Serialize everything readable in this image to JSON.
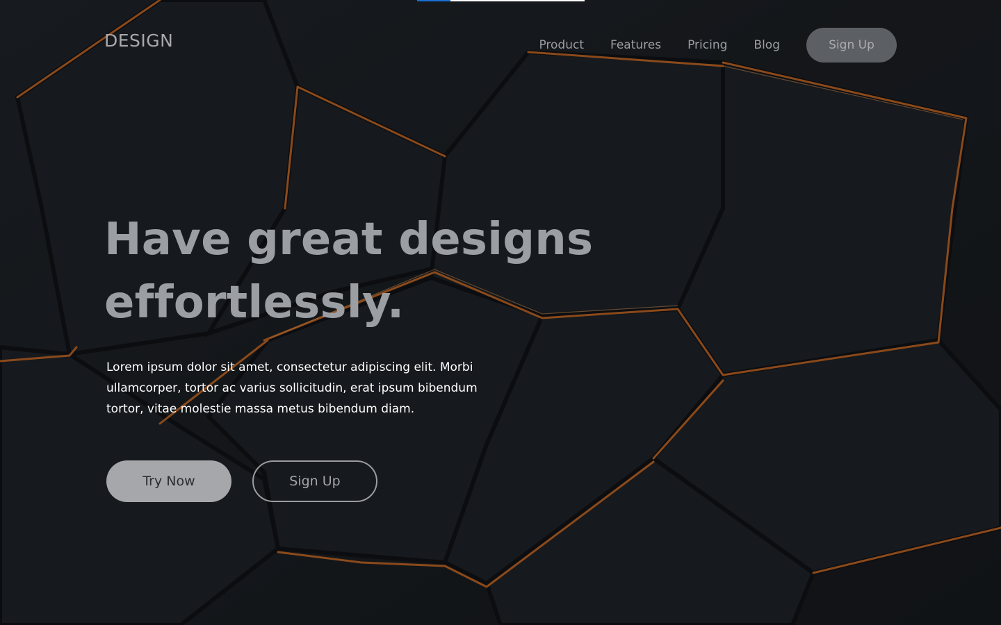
{
  "progress": {
    "value": 0.2,
    "fill_color": "#1a6fd6",
    "track_color": "#ffffff"
  },
  "brand": {
    "logo_text": "DESIGN"
  },
  "nav": {
    "links": [
      "Product",
      "Features",
      "Pricing",
      "Blog"
    ],
    "signup_label": "Sign Up"
  },
  "hero": {
    "title": "Have great designs effortlessly.",
    "body": "Lorem ipsum dolor sit amet, consectetur adipiscing elit. Morbi ullamcorper, tortor ac varius sollicitudin, erat ipsum bibendum tortor, vitae molestie massa metus bibendum diam.",
    "primary_button": "Try Now",
    "secondary_button": "Sign Up"
  },
  "colors": {
    "background": "#16191d",
    "accent_orange": "#c8661e",
    "title_gray": "#9b9ea2"
  }
}
